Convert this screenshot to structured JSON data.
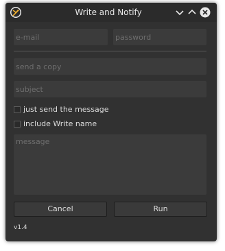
{
  "window": {
    "title": "Write and Notify",
    "app_icon": "quill-feather-icon",
    "controls": {
      "minimize_icon": "chevron-down-icon",
      "maximize_icon": "chevron-up-icon",
      "close_icon": "close-circle-icon"
    }
  },
  "form": {
    "email": {
      "value": "",
      "placeholder": "e-mail"
    },
    "password": {
      "value": "",
      "placeholder": "password"
    },
    "send_copy": {
      "value": "",
      "placeholder": "send a copy"
    },
    "subject": {
      "value": "",
      "placeholder": "subject"
    },
    "options": {
      "just_send": {
        "label": "just send the message",
        "checked": false
      },
      "include_name": {
        "label": "include Write name",
        "checked": false
      }
    },
    "message": {
      "value": "",
      "placeholder": "message"
    }
  },
  "buttons": {
    "cancel_label": "Cancel",
    "run_label": "Run"
  },
  "footer": {
    "version": "v1.4"
  },
  "colors": {
    "window_bg": "#313131",
    "titlebar_bg": "#2b2b2b",
    "field_bg": "#3b3b3b",
    "placeholder": "#6e6e6e",
    "text": "#dcdcdc",
    "icon_accent": "#f0b030"
  }
}
